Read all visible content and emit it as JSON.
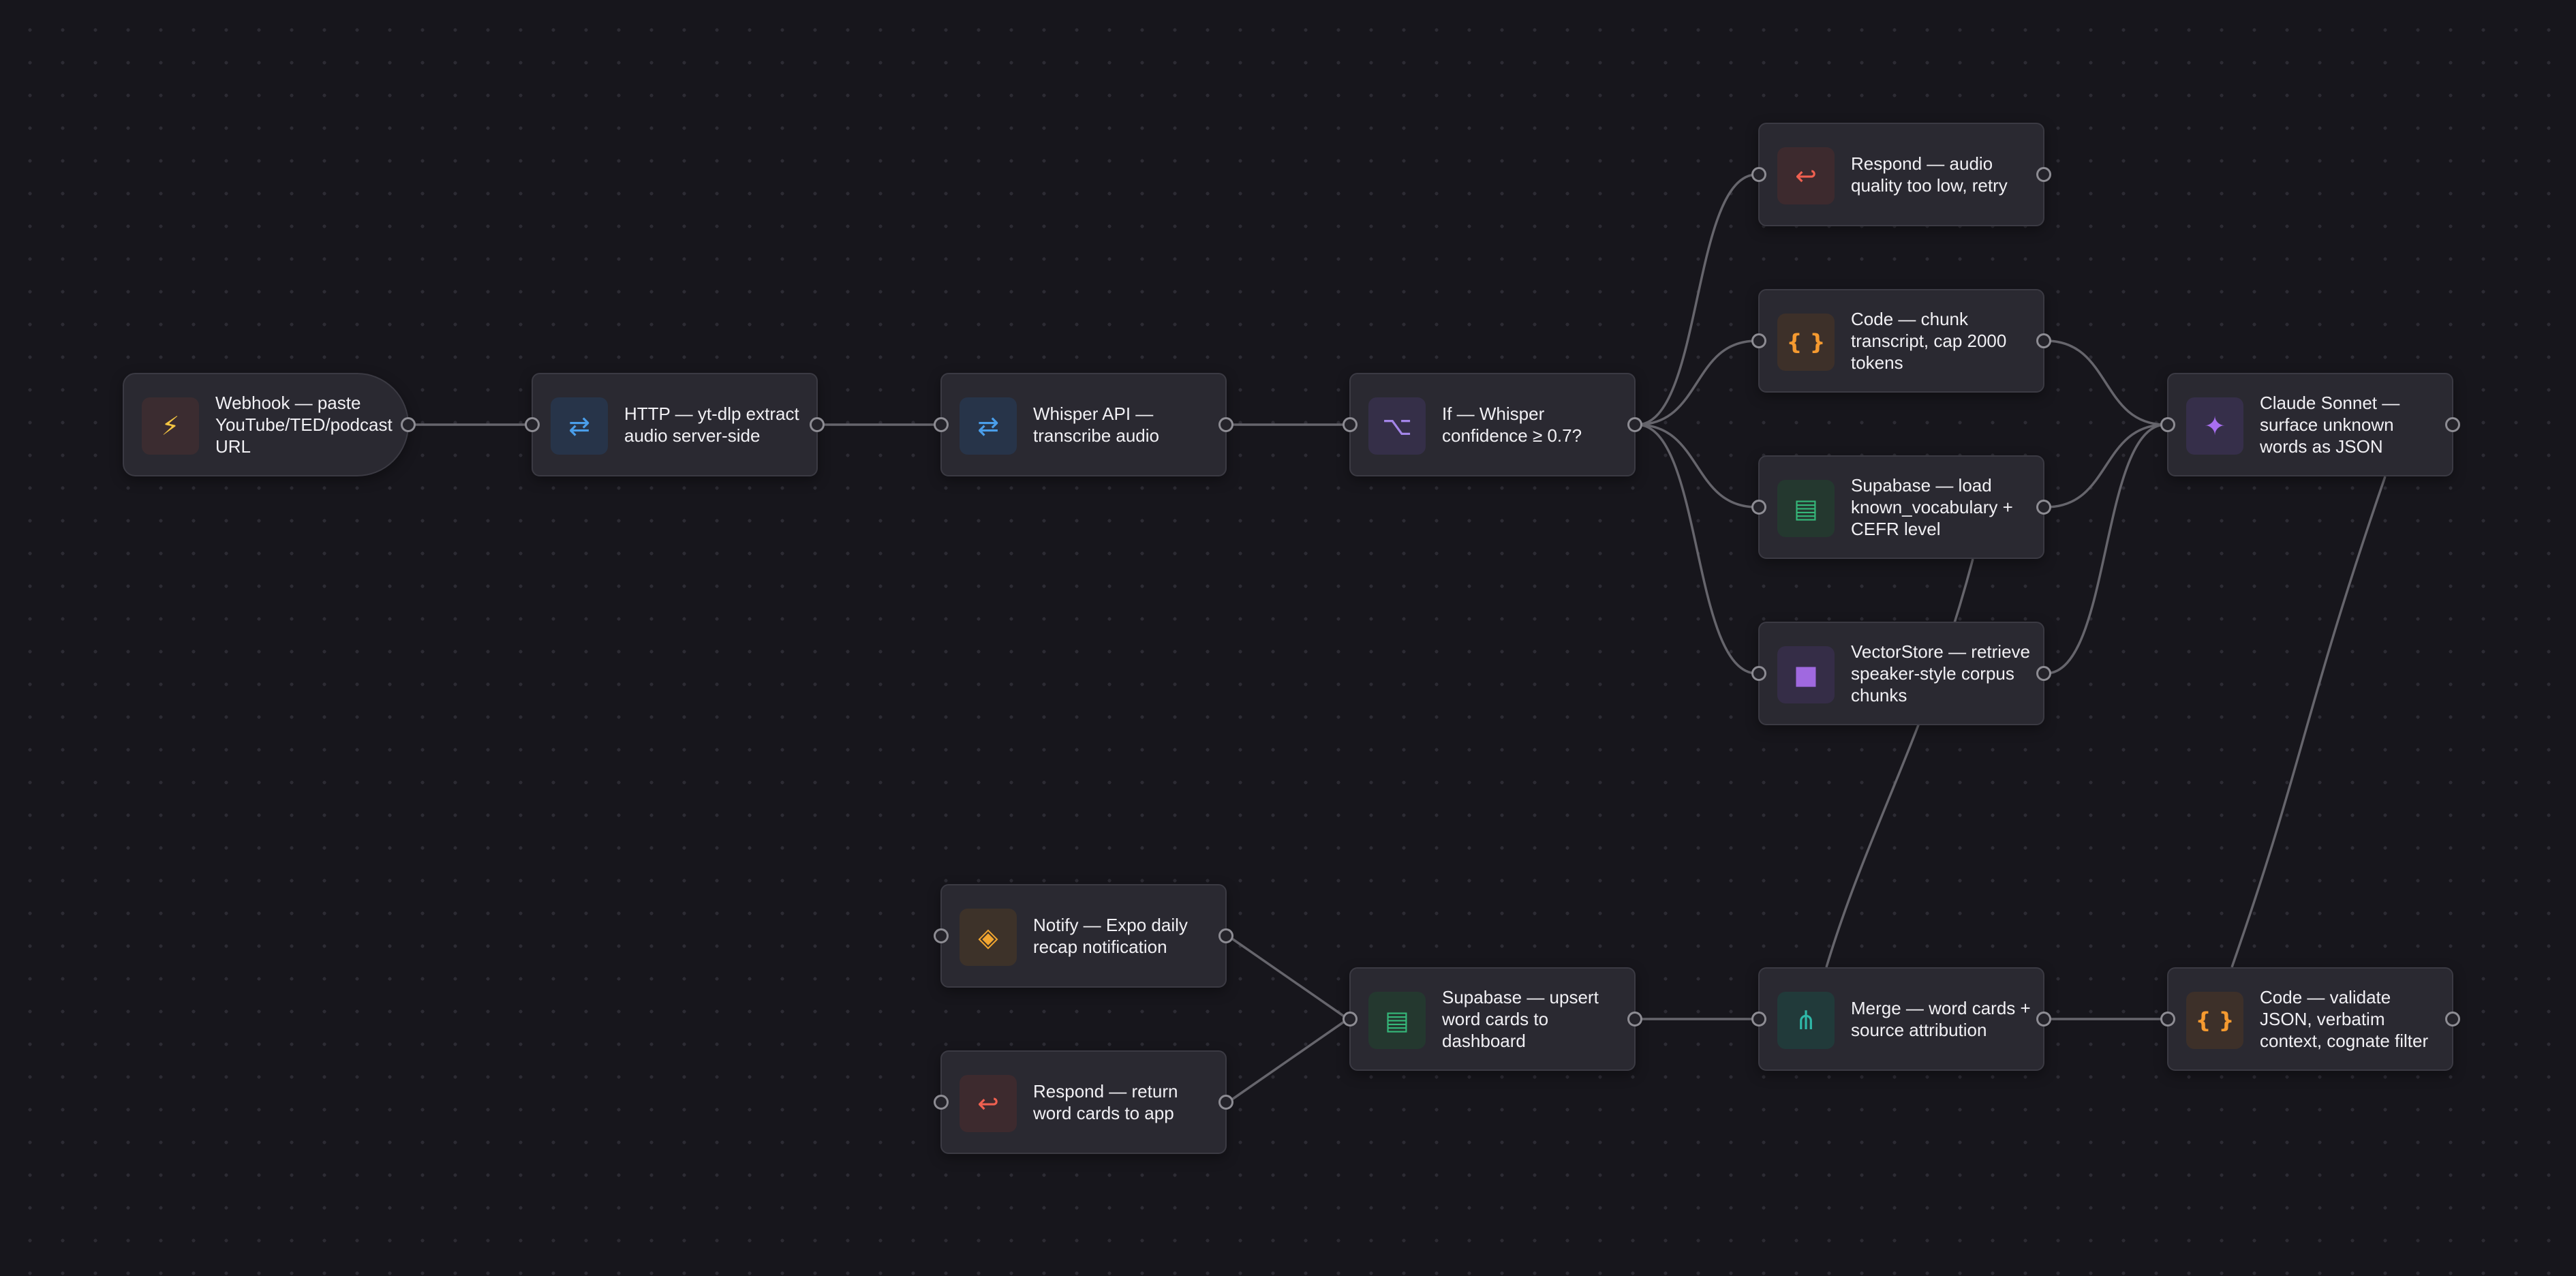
{
  "workflow": {
    "nodes": [
      {
        "id": "webhook",
        "label": "Webhook — paste YouTube/TED/podcast URL",
        "icon": "lightning-icon",
        "glyph": "⚡",
        "color": "#f5c542",
        "bg": "#3b2c30",
        "shape": "trigger"
      },
      {
        "id": "http",
        "label": "HTTP — yt-dlp extract audio server-side",
        "icon": "swap-arrows-icon",
        "glyph": "⇄",
        "color": "#4a9eea",
        "bg": "#273449"
      },
      {
        "id": "whisper",
        "label": "Whisper API — transcribe audio",
        "icon": "swap-arrows-icon",
        "glyph": "⇄",
        "color": "#4a9eea",
        "bg": "#273449"
      },
      {
        "id": "if",
        "label": "If — Whisper confidence ≥ 0.7?",
        "icon": "branch-icon",
        "glyph": "⌥",
        "color": "#a385e8",
        "bg": "#352f48"
      },
      {
        "id": "respond_low",
        "label": "Respond — audio quality too low, retry",
        "icon": "return-arrow-icon",
        "glyph": "↩",
        "color": "#f06050",
        "bg": "#3d2a2e"
      },
      {
        "id": "code_chunk",
        "label": "Code — chunk transcript, cap 2000 tokens",
        "icon": "code-braces-icon",
        "glyph": "{ }",
        "color": "#f59a30",
        "bg": "#3d3029"
      },
      {
        "id": "supabase_load",
        "label": "Supabase — load known_vocabulary + CEFR level",
        "icon": "database-icon",
        "glyph": "▤",
        "color": "#35b87a",
        "bg": "#24382f"
      },
      {
        "id": "vectorstore",
        "label": "VectorStore — retrieve speaker-style corpus chunks",
        "icon": "vector-cube-icon",
        "glyph": "■",
        "color": "#a069e0",
        "bg": "#352d47"
      },
      {
        "id": "claude",
        "label": "Claude Sonnet — surface unknown words as JSON",
        "icon": "sparkle-icon",
        "glyph": "✦",
        "color": "#a86ff0",
        "bg": "#362f4a"
      },
      {
        "id": "code_validate",
        "label": "Code — validate JSON, verbatim context, cognate filter",
        "icon": "code-braces-icon",
        "glyph": "{ }",
        "color": "#f59a30",
        "bg": "#3d3029"
      },
      {
        "id": "merge",
        "label": "Merge — word cards + source attribution",
        "icon": "merge-icon",
        "glyph": "⋔",
        "color": "#2fb8a8",
        "bg": "#213a3a"
      },
      {
        "id": "supabase_upsert",
        "label": "Supabase — upsert word cards to dashboard",
        "icon": "database-icon",
        "glyph": "▤",
        "color": "#35b87a",
        "bg": "#24382f"
      },
      {
        "id": "notify",
        "label": "Notify — Expo daily recap notification",
        "icon": "diamond-icon",
        "glyph": "◈",
        "color": "#f2a630",
        "bg": "#3d3229"
      },
      {
        "id": "respond_return",
        "label": "Respond — return word cards to app",
        "icon": "return-arrow-icon",
        "glyph": "↩",
        "color": "#f06050",
        "bg": "#3d2a2e"
      }
    ],
    "edges": [
      [
        "webhook",
        "http"
      ],
      [
        "http",
        "whisper"
      ],
      [
        "whisper",
        "if"
      ],
      [
        "if",
        "respond_low"
      ],
      [
        "if",
        "code_chunk"
      ],
      [
        "if",
        "supabase_load"
      ],
      [
        "if",
        "vectorstore"
      ],
      [
        "code_chunk",
        "claude"
      ],
      [
        "supabase_load",
        "claude"
      ],
      [
        "vectorstore",
        "claude"
      ],
      [
        "claude",
        "code_validate"
      ],
      [
        "supabase_load",
        "merge"
      ],
      [
        "code_validate",
        "merge"
      ],
      [
        "merge",
        "supabase_upsert"
      ],
      [
        "supabase_upsert",
        "notify"
      ],
      [
        "supabase_upsert",
        "respond_return"
      ]
    ]
  },
  "theme": {
    "canvas_bg": "#17161c",
    "node_bg": "#2a2931",
    "edge_color": "#66656c"
  }
}
